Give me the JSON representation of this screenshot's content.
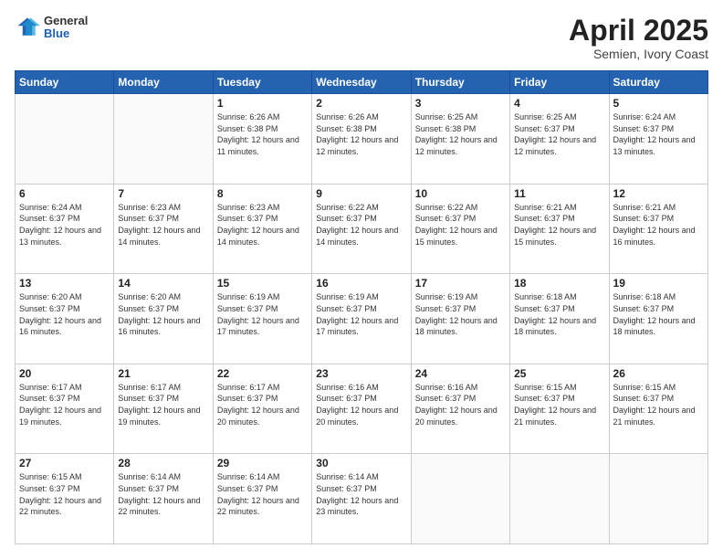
{
  "header": {
    "logo": {
      "general": "General",
      "blue": "Blue"
    },
    "title": "April 2025",
    "location": "Semien, Ivory Coast"
  },
  "weekdays": [
    "Sunday",
    "Monday",
    "Tuesday",
    "Wednesday",
    "Thursday",
    "Friday",
    "Saturday"
  ],
  "weeks": [
    [
      {
        "day": null,
        "sunrise": null,
        "sunset": null,
        "daylight": null
      },
      {
        "day": null,
        "sunrise": null,
        "sunset": null,
        "daylight": null
      },
      {
        "day": "1",
        "sunrise": "6:26 AM",
        "sunset": "6:38 PM",
        "daylight": "12 hours and 11 minutes."
      },
      {
        "day": "2",
        "sunrise": "6:26 AM",
        "sunset": "6:38 PM",
        "daylight": "12 hours and 12 minutes."
      },
      {
        "day": "3",
        "sunrise": "6:25 AM",
        "sunset": "6:38 PM",
        "daylight": "12 hours and 12 minutes."
      },
      {
        "day": "4",
        "sunrise": "6:25 AM",
        "sunset": "6:37 PM",
        "daylight": "12 hours and 12 minutes."
      },
      {
        "day": "5",
        "sunrise": "6:24 AM",
        "sunset": "6:37 PM",
        "daylight": "12 hours and 13 minutes."
      }
    ],
    [
      {
        "day": "6",
        "sunrise": "6:24 AM",
        "sunset": "6:37 PM",
        "daylight": "12 hours and 13 minutes."
      },
      {
        "day": "7",
        "sunrise": "6:23 AM",
        "sunset": "6:37 PM",
        "daylight": "12 hours and 14 minutes."
      },
      {
        "day": "8",
        "sunrise": "6:23 AM",
        "sunset": "6:37 PM",
        "daylight": "12 hours and 14 minutes."
      },
      {
        "day": "9",
        "sunrise": "6:22 AM",
        "sunset": "6:37 PM",
        "daylight": "12 hours and 14 minutes."
      },
      {
        "day": "10",
        "sunrise": "6:22 AM",
        "sunset": "6:37 PM",
        "daylight": "12 hours and 15 minutes."
      },
      {
        "day": "11",
        "sunrise": "6:21 AM",
        "sunset": "6:37 PM",
        "daylight": "12 hours and 15 minutes."
      },
      {
        "day": "12",
        "sunrise": "6:21 AM",
        "sunset": "6:37 PM",
        "daylight": "12 hours and 16 minutes."
      }
    ],
    [
      {
        "day": "13",
        "sunrise": "6:20 AM",
        "sunset": "6:37 PM",
        "daylight": "12 hours and 16 minutes."
      },
      {
        "day": "14",
        "sunrise": "6:20 AM",
        "sunset": "6:37 PM",
        "daylight": "12 hours and 16 minutes."
      },
      {
        "day": "15",
        "sunrise": "6:19 AM",
        "sunset": "6:37 PM",
        "daylight": "12 hours and 17 minutes."
      },
      {
        "day": "16",
        "sunrise": "6:19 AM",
        "sunset": "6:37 PM",
        "daylight": "12 hours and 17 minutes."
      },
      {
        "day": "17",
        "sunrise": "6:19 AM",
        "sunset": "6:37 PM",
        "daylight": "12 hours and 18 minutes."
      },
      {
        "day": "18",
        "sunrise": "6:18 AM",
        "sunset": "6:37 PM",
        "daylight": "12 hours and 18 minutes."
      },
      {
        "day": "19",
        "sunrise": "6:18 AM",
        "sunset": "6:37 PM",
        "daylight": "12 hours and 18 minutes."
      }
    ],
    [
      {
        "day": "20",
        "sunrise": "6:17 AM",
        "sunset": "6:37 PM",
        "daylight": "12 hours and 19 minutes."
      },
      {
        "day": "21",
        "sunrise": "6:17 AM",
        "sunset": "6:37 PM",
        "daylight": "12 hours and 19 minutes."
      },
      {
        "day": "22",
        "sunrise": "6:17 AM",
        "sunset": "6:37 PM",
        "daylight": "12 hours and 20 minutes."
      },
      {
        "day": "23",
        "sunrise": "6:16 AM",
        "sunset": "6:37 PM",
        "daylight": "12 hours and 20 minutes."
      },
      {
        "day": "24",
        "sunrise": "6:16 AM",
        "sunset": "6:37 PM",
        "daylight": "12 hours and 20 minutes."
      },
      {
        "day": "25",
        "sunrise": "6:15 AM",
        "sunset": "6:37 PM",
        "daylight": "12 hours and 21 minutes."
      },
      {
        "day": "26",
        "sunrise": "6:15 AM",
        "sunset": "6:37 PM",
        "daylight": "12 hours and 21 minutes."
      }
    ],
    [
      {
        "day": "27",
        "sunrise": "6:15 AM",
        "sunset": "6:37 PM",
        "daylight": "12 hours and 22 minutes."
      },
      {
        "day": "28",
        "sunrise": "6:14 AM",
        "sunset": "6:37 PM",
        "daylight": "12 hours and 22 minutes."
      },
      {
        "day": "29",
        "sunrise": "6:14 AM",
        "sunset": "6:37 PM",
        "daylight": "12 hours and 22 minutes."
      },
      {
        "day": "30",
        "sunrise": "6:14 AM",
        "sunset": "6:37 PM",
        "daylight": "12 hours and 23 minutes."
      },
      {
        "day": null,
        "sunrise": null,
        "sunset": null,
        "daylight": null
      },
      {
        "day": null,
        "sunrise": null,
        "sunset": null,
        "daylight": null
      },
      {
        "day": null,
        "sunrise": null,
        "sunset": null,
        "daylight": null
      }
    ]
  ]
}
